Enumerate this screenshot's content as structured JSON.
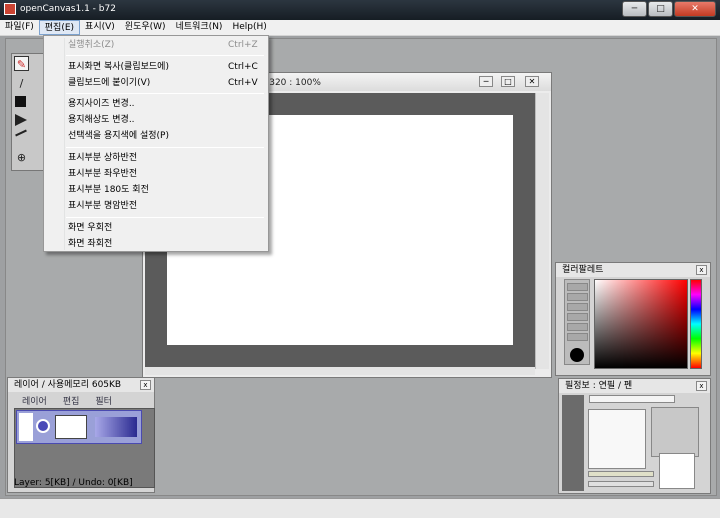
{
  "window": {
    "title": "openCanvas1.1 - b72",
    "minimize_glyph": "─",
    "maximize_glyph": "□",
    "close_glyph": "✕"
  },
  "menubar": [
    {
      "label": "파일(F)"
    },
    {
      "label": "편집(E)"
    },
    {
      "label": "표시(V)"
    },
    {
      "label": "윈도우(W)"
    },
    {
      "label": "네트워크(N)"
    },
    {
      "label": "Help(H)"
    }
  ],
  "edit_menu": {
    "undo": {
      "label": "실행취소(Z)",
      "shortcut": "Ctrl+Z"
    },
    "copy": {
      "label": "표시화면 복사(클립보드에)",
      "shortcut": "Ctrl+C"
    },
    "paste": {
      "label": "클립보드에 붙이기(V)",
      "shortcut": "Ctrl+V"
    },
    "paper_size": {
      "label": "용지사이즈 변경.."
    },
    "paper_resolution": {
      "label": "용지해상도 변경.."
    },
    "selected_color_paper": {
      "label": "선택색을 용지색에 설정(P)"
    },
    "flip_vertical": {
      "label": "표시부분 상하반전"
    },
    "flip_horizontal": {
      "label": "표시부분 좌우반전"
    },
    "rotate_180": {
      "label": "표시부분 180도 회전"
    },
    "invert_brightness": {
      "label": "표시부분 명암반전"
    },
    "rotate_right": {
      "label": "화면 우회전"
    },
    "rotate_left": {
      "label": "화면 좌회전"
    }
  },
  "canvas_window": {
    "title": "0*320 : 100%",
    "minimize_glyph": "─",
    "maximize_glyph": "□",
    "close_glyph": "✕"
  },
  "layer_panel": {
    "title": "레이어 / 사용메모리 605KB",
    "tabs": [
      "레이어",
      "편집",
      "필터"
    ],
    "status": "Layer: 5[KB] / Undo: 0[KB]",
    "close_glyph": "x"
  },
  "palette_panel": {
    "title": "컬러팔레트",
    "close_glyph": "x"
  },
  "pen_panel": {
    "title": "필정보 : 연필  /  펜",
    "close_glyph": "x"
  },
  "tools": {
    "pencil_glyph": "✎",
    "dropper_glyph": "/",
    "zoom_glyph": "⊕"
  },
  "colors": {
    "selection_bar": "#4b4bb8",
    "palette_red": "#ff0000"
  }
}
